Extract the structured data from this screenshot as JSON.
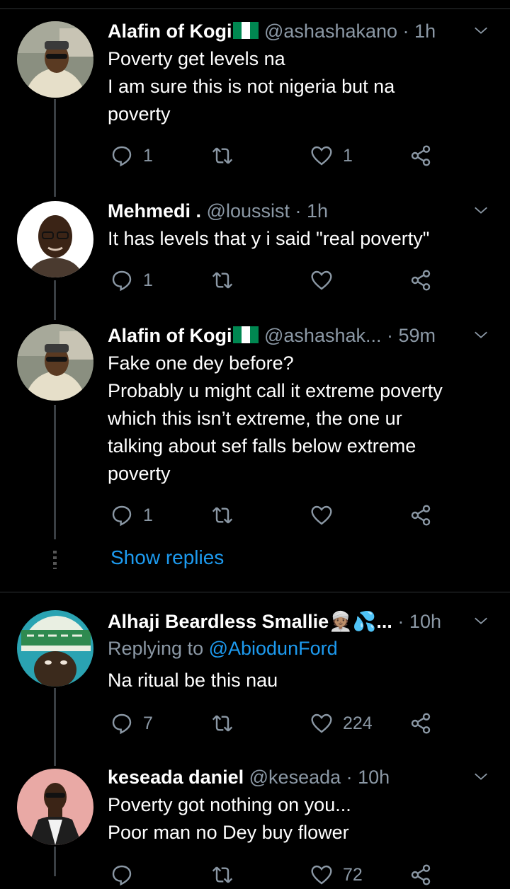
{
  "tweets": [
    {
      "name": "Alafin of Kogi",
      "flag": "nigeria-flag",
      "handle": "@ashashakano",
      "sep": " · ",
      "time": "1h",
      "lines": [
        "Poverty get levels na",
        "I am sure this is not nigeria but na",
        "poverty"
      ],
      "reply_count": "1",
      "retweet_count": "",
      "like_count": "1"
    },
    {
      "name": "Mehmedi .",
      "handle": "@loussist",
      "sep": " · ",
      "time": "1h",
      "lines": [
        "It has levels that y i said \"real poverty\""
      ],
      "reply_count": "1",
      "retweet_count": "",
      "like_count": ""
    },
    {
      "name": "Alafin of Kogi",
      "flag": "nigeria-flag",
      "handle": "@ashashak...",
      "sep": " · ",
      "time": "59m",
      "lines": [
        "Fake one dey before?",
        "Probably u might call it extreme poverty",
        "which this isn’t extreme, the one ur",
        "talking about sef falls below extreme",
        "poverty"
      ],
      "reply_count": "1",
      "retweet_count": "",
      "like_count": ""
    },
    {
      "name": "Alhaji Beardless Smallie",
      "emoji": "👳🏽💦...",
      "handle": "",
      "sep": " · ",
      "time": "10h",
      "replying_prefix": "Replying to ",
      "replying_to": "@AbiodunFord",
      "lines": [
        "Na ritual be this nau"
      ],
      "reply_count": "7",
      "retweet_count": "",
      "like_count": "224"
    },
    {
      "name": "keseada daniel",
      "handle": "@keseada",
      "sep": " · ",
      "time": "10h",
      "lines": [
        "Poverty got nothing on you...",
        "Poor man no Dey buy flower"
      ],
      "reply_count": "",
      "retweet_count": "",
      "like_count": "72"
    }
  ],
  "show_replies": "Show replies",
  "colors": {
    "background": "#000000",
    "secondary_text": "#8b98a5",
    "link": "#1d9bf0",
    "divider": "#2f3336"
  }
}
